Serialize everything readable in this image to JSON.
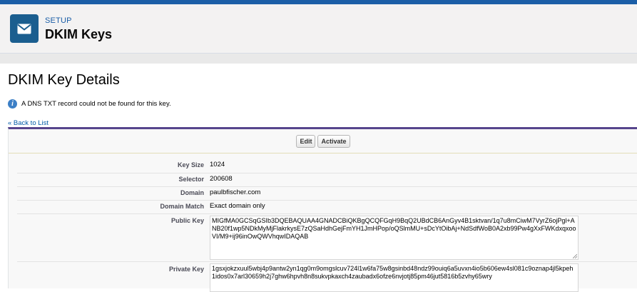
{
  "header": {
    "breadcrumb": "SETUP",
    "title": "DKIM Keys",
    "icon": "envelope-icon"
  },
  "detail": {
    "title": "DKIM Key Details",
    "info_message": "A DNS TXT record could not be found for this key.",
    "back_link": "« Back to List"
  },
  "buttons": {
    "edit": "Edit",
    "activate": "Activate"
  },
  "fields": {
    "key_size": {
      "label": "Key Size",
      "value": "1024"
    },
    "selector": {
      "label": "Selector",
      "value": "200608"
    },
    "domain": {
      "label": "Domain",
      "value": "paulbfischer.com"
    },
    "domain_match": {
      "label": "Domain Match",
      "value": "Exact domain only"
    },
    "public_key": {
      "label": "Public Key",
      "value": "MIGfMA0GCSqGSIb3DQEBAQUAA4GNADCBiQKBgQCQFGqH9BqQ2UBdCB6AnGyv4B1sktvan/1q7u8mCiwM7VyrZ6ojPgl+ANB20f1wp5NDkMyMjFlakrkysE7zQSaHdhGejFmYH1JmHPop/oQSlmMU+sDcYtOibAj+NdSdfWoB0A2xb99Pw4gXxFWKdxqxooVI/M9+ij96inOwQWVhqwIDAQAB"
    },
    "private_key": {
      "label": "Private Key",
      "value": "1gsxjokzxuul5wbj4p9antw2yn1qg0m9omgslcuv724l1w6fa75w8gsinbd48ndz99ouiq6a5uvxn4io5b606ew4sl081c9oznap4jl5kpeh1idos0x7arl30659h2j7ghw6hpvh8n8sukvpkaxch4zaubadx6ofze6nvjotj85pm46jut5816b5zvhy65wry"
    }
  },
  "colors": {
    "brand_blue": "#1b5ea7",
    "icon_tile": "#1b5e8f",
    "panel_top_border": "#56458c",
    "link": "#015ba7"
  }
}
